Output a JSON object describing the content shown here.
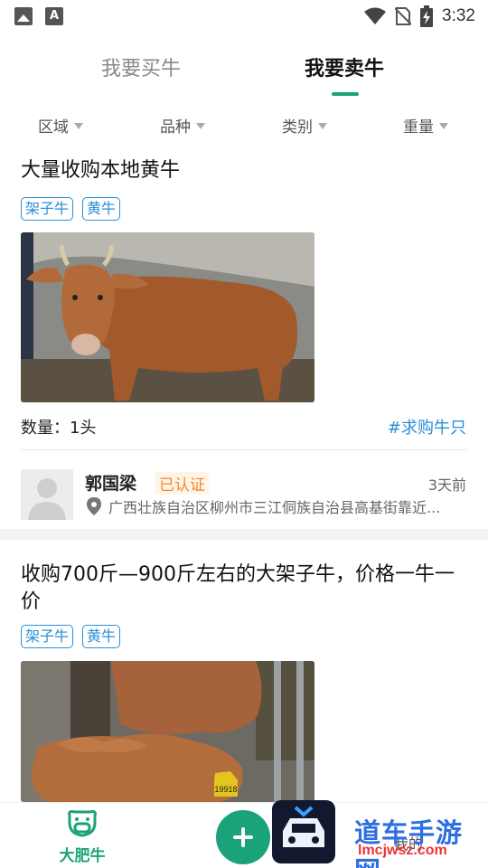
{
  "status_bar": {
    "time": "3:32",
    "left_icons": [
      "image-icon",
      "a-icon"
    ],
    "right_icons": [
      "wifi-icon",
      "no-sim-icon",
      "battery-charging-icon"
    ]
  },
  "tabs": [
    {
      "label": "我要买牛",
      "active": false
    },
    {
      "label": "我要卖牛",
      "active": true
    }
  ],
  "filters": [
    "区域",
    "品种",
    "类别",
    "重量"
  ],
  "listings": [
    {
      "title": "大量收购本地黄牛",
      "tags": [
        "架子牛",
        "黄牛"
      ],
      "quantity": "数量：1头",
      "hashtag": "#求购牛只",
      "seller": {
        "name": "郭国梁",
        "verified": "已认证",
        "posted": "3天前",
        "location": "广西壮族自治区柳州市三江侗族自治县高基街靠近..."
      }
    },
    {
      "title": "收购700斤—900斤左右的大架子牛，价格一牛一价",
      "tags": [
        "架子牛",
        "黄牛"
      ],
      "ear_tag": "19918"
    }
  ],
  "bottom_nav": {
    "home_label": "大肥牛",
    "me_label": "我的"
  },
  "watermark": {
    "text": "道车手游网",
    "url": "lmcjwsz.com"
  },
  "colors": {
    "accent": "#1aa37a",
    "link": "#2a8fd8",
    "verified": "#f08a2c"
  }
}
